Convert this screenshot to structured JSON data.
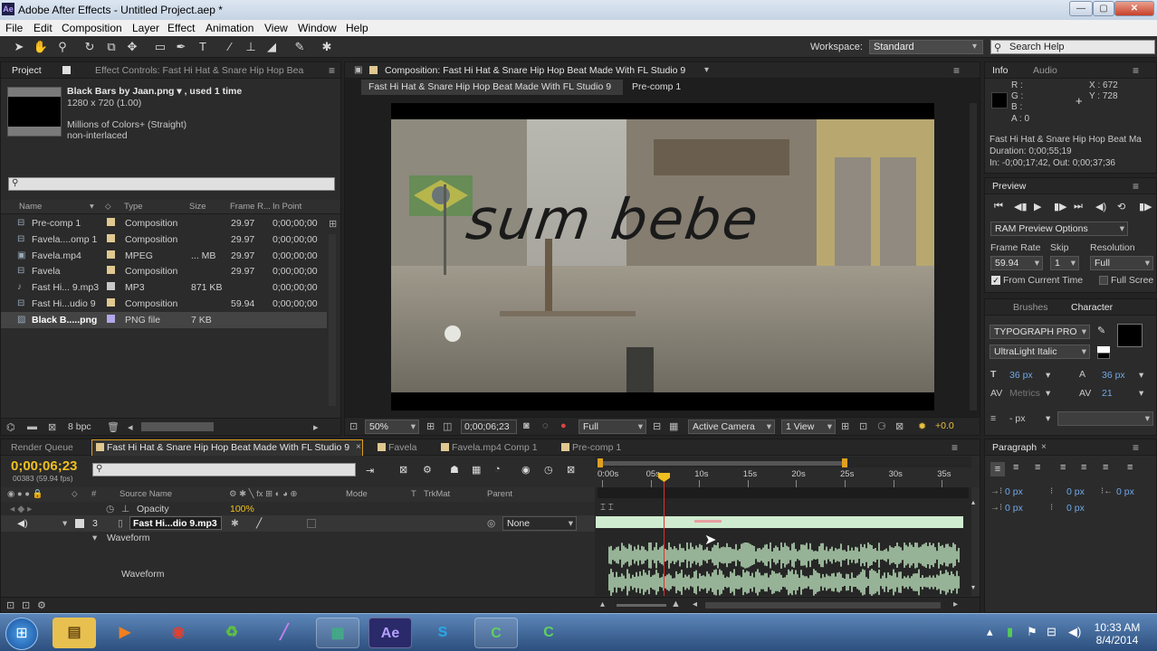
{
  "window": {
    "title": "Adobe After Effects - Untitled Project.aep *",
    "app_logo": "Ae",
    "min": "—",
    "max": "▢",
    "close": "✕"
  },
  "menu": [
    "File",
    "Edit",
    "Composition",
    "Layer",
    "Effect",
    "Animation",
    "View",
    "Window",
    "Help"
  ],
  "toolbar": {
    "workspace_label": "Workspace:",
    "workspace_value": "Standard",
    "search_placeholder": "Search Help"
  },
  "project": {
    "tab_project": "Project",
    "tab_effect": "Effect Controls: Fast Hi Hat & Snare Hip Hop Bea",
    "selected_name": "Black Bars by Jaan.png ▾ , used 1 time",
    "selected_dims": "1280 x 720 (1.00)",
    "selected_colors": "Millions of Colors+ (Straight)",
    "selected_interlace": "non-interlaced",
    "columns": [
      "Name",
      "Type",
      "Size",
      "Frame R...",
      "In Point"
    ],
    "items": [
      {
        "name": "Pre-comp 1",
        "type": "Composition",
        "size": "",
        "fps": "29.97",
        "in": "0;00;00;00",
        "color": "#e0c890"
      },
      {
        "name": "Favela....omp 1",
        "type": "Composition",
        "size": "",
        "fps": "29.97",
        "in": "0;00;00;00",
        "color": "#e0c890"
      },
      {
        "name": "Favela.mp4",
        "type": "MPEG",
        "size": "... MB",
        "fps": "29.97",
        "in": "0;00;00;00",
        "color": "#e0c890"
      },
      {
        "name": "Favela",
        "type": "Composition",
        "size": "",
        "fps": "29.97",
        "in": "0;00;00;00",
        "color": "#e0c890"
      },
      {
        "name": "Fast Hi... 9.mp3",
        "type": "MP3",
        "size": "871 KB",
        "fps": "",
        "in": "0;00;00;00",
        "color": "#c8c8c8"
      },
      {
        "name": "Fast Hi...udio 9",
        "type": "Composition",
        "size": "",
        "fps": "59.94",
        "in": "0;00;00;00",
        "color": "#e0c890"
      },
      {
        "name": "Black B.....png",
        "type": "PNG file",
        "size": "7 KB",
        "fps": "",
        "in": "",
        "color": "#b0a8e8"
      }
    ],
    "bpc": "8 bpc"
  },
  "composition": {
    "tab": "Composition: Fast Hi Hat & Snare Hip Hop Beat Made With FL Studio 9",
    "crumb1": "Fast Hi Hat & Snare Hip Hop Beat Made With FL Studio 9",
    "crumb2": "Pre-comp 1",
    "overlay_text": "sum bebe",
    "zoom": "50%",
    "timecode": "0;00;06;23",
    "resolution": "Full",
    "camera": "Active Camera",
    "view": "1 View",
    "exposure": "+0.0"
  },
  "info": {
    "tab_info": "Info",
    "tab_audio": "Audio",
    "r": "R :",
    "g": "G :",
    "b": "B :",
    "a": "A : 0",
    "x": "X : 672",
    "y": "Y : 728",
    "name": "Fast Hi Hat & Snare Hip Hop Beat Ma",
    "duration": "Duration: 0;00;55;19",
    "inout": "In: -0;00;17;42, Out: 0;00;37;36"
  },
  "preview": {
    "tab": "Preview",
    "ram": "RAM Preview Options",
    "frame_rate_label": "Frame Rate",
    "skip_label": "Skip",
    "resolution_label": "Resolution",
    "frame_rate": "59.94",
    "skip": "1",
    "resolution": "Full",
    "from_current": "From Current Time",
    "full_screen": "Full Scree"
  },
  "character": {
    "tab_brushes": "Brushes",
    "tab_character": "Character",
    "font": "TYPOGRAPH PRO",
    "style": "UltraLight Italic",
    "size": "36 px",
    "leading": "36 px",
    "kerning": "Metrics",
    "tracking": "21",
    "stroke": "- px"
  },
  "paragraph": {
    "tab": "Paragraph",
    "v1": "0 px",
    "v2": "0 px",
    "v3": "0 px",
    "v4": "0 px",
    "v5": "0 px"
  },
  "timeline": {
    "tabs": [
      "Render Queue",
      "Fast Hi Hat & Snare Hip Hop Beat Made With FL Studio 9",
      "Favela",
      "Favela.mp4 Comp 1",
      "Pre-comp 1"
    ],
    "timecode": "0;00;06;23",
    "frames": "00383 (59.94 fps)",
    "col_source": "Source Name",
    "col_mode": "Mode",
    "col_t": "T",
    "col_trkmat": "TrkMat",
    "col_parent": "Parent",
    "opacity_label": "Opacity",
    "opacity_value": "100%",
    "layer_num": "3",
    "layer_name": "Fast Hi...dio 9.mp3",
    "parent_value": "None",
    "waveform_group": "Waveform",
    "waveform_prop": "Waveform",
    "ruler": [
      "0:00s",
      "05s",
      "10s",
      "15s",
      "20s",
      "25s",
      "30s",
      "35s"
    ]
  },
  "taskbar": {
    "time": "10:33 AM",
    "date": "8/4/2014"
  },
  "colors": {
    "accent": "#f0c020",
    "playhead": "#e03030",
    "waveform": "#c8f0c8"
  }
}
